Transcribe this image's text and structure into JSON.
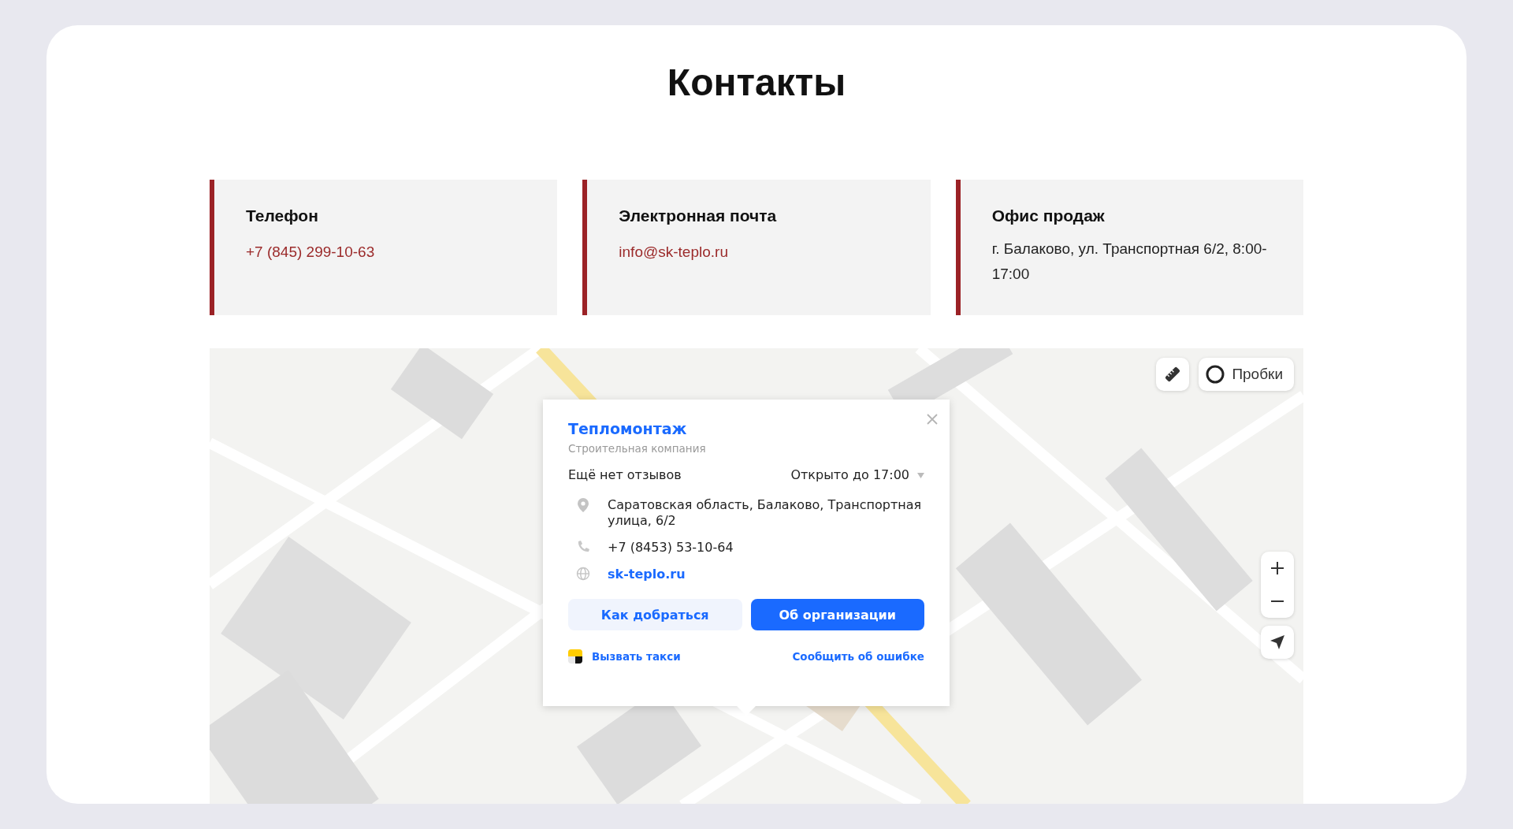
{
  "title": "Контакты",
  "contacts": [
    {
      "label": "Телефон",
      "value": "+7 (845) 299-10-63",
      "kind": "link"
    },
    {
      "label": "Электронная почта",
      "value": "info@sk-teplo.ru",
      "kind": "link"
    },
    {
      "label": "Офис продаж",
      "value": "г. Балаково, ул. Транспортная 6/2, 8:00-17:00",
      "kind": "text"
    }
  ],
  "map": {
    "traffic_button": "Пробки",
    "popup": {
      "name": "Тепломонтаж",
      "category": "Строительная компания",
      "reviews": "Ещё нет отзывов",
      "hours": "Открыто до 17:00",
      "address": "Саратовская область, Балаково, Транспортная улица, 6/2",
      "phone": "+7 (8453) 53-10-64",
      "website": "sk-teplo.ru",
      "route_button": "Как добраться",
      "about_button": "Об организации",
      "taxi_link": "Вызвать такси",
      "report_link": "Сообщить об ошибке"
    }
  }
}
